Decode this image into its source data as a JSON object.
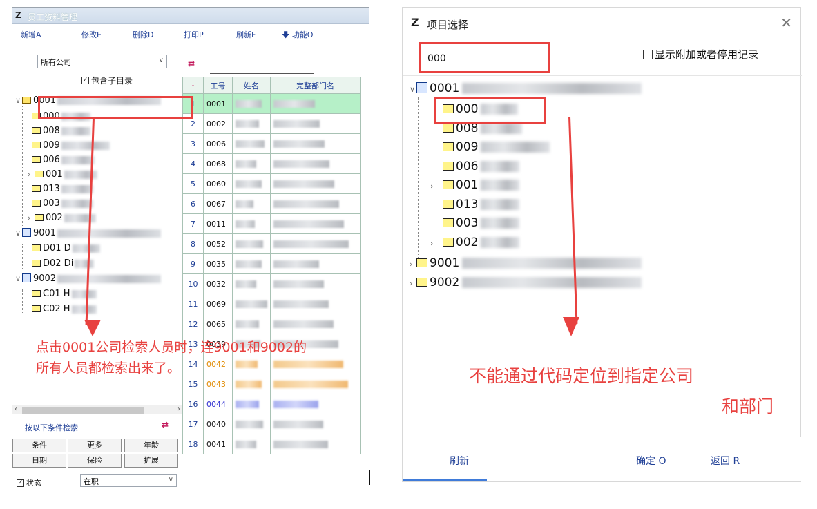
{
  "left": {
    "title": "员工资料管理",
    "toolbar": [
      {
        "label": "新增A"
      },
      {
        "label": "修改E"
      },
      {
        "label": "删除D"
      },
      {
        "label": "打印P"
      },
      {
        "label": "刷新F"
      },
      {
        "label": "功能O"
      }
    ],
    "company_select": "所有公司",
    "include_subdir": "包含子目录",
    "tree": [
      {
        "code": "0001"
      },
      {
        "code": "000"
      },
      {
        "code": "008"
      },
      {
        "code": "009"
      },
      {
        "code": "006"
      },
      {
        "code": "001"
      },
      {
        "code": "013"
      },
      {
        "code": "003"
      },
      {
        "code": "002"
      },
      {
        "code": "9001"
      },
      {
        "code": "D01 D"
      },
      {
        "code": "D02 Di"
      },
      {
        "code": "9002"
      },
      {
        "code": "C01 H"
      },
      {
        "code": "C02 H"
      }
    ],
    "cond_title": "按以下条件检索",
    "cond_buttons": [
      "条件",
      "更多",
      "年龄",
      "日期",
      "保险",
      "扩展"
    ],
    "status_label": "状态",
    "status_value": "在职",
    "grid": {
      "headers": [
        "-",
        "工号",
        "姓名",
        "完整部门名"
      ],
      "rows": [
        {
          "n": "1",
          "code": "0001"
        },
        {
          "n": "2",
          "code": "0002"
        },
        {
          "n": "3",
          "code": "0006"
        },
        {
          "n": "4",
          "code": "0068"
        },
        {
          "n": "5",
          "code": "0060"
        },
        {
          "n": "6",
          "code": "0067"
        },
        {
          "n": "7",
          "code": "0011"
        },
        {
          "n": "8",
          "code": "0052"
        },
        {
          "n": "9",
          "code": "0035"
        },
        {
          "n": "10",
          "code": "0032"
        },
        {
          "n": "11",
          "code": "0069"
        },
        {
          "n": "12",
          "code": "0065"
        },
        {
          "n": "13",
          "code": "0039"
        },
        {
          "n": "14",
          "code": "0042"
        },
        {
          "n": "15",
          "code": "0043"
        },
        {
          "n": "16",
          "code": "0044"
        },
        {
          "n": "17",
          "code": "0040"
        },
        {
          "n": "18",
          "code": "0041"
        }
      ]
    },
    "note_line1": "点击0001公司检索人员时，连9001和9002的",
    "note_line2": "所有人员都检索出来了。"
  },
  "right": {
    "title": "项目选择",
    "search_value": "000",
    "show_extra": "显示附加或者停用记录",
    "tree": [
      {
        "code": "0001"
      },
      {
        "code": "000"
      },
      {
        "code": "008"
      },
      {
        "code": "009"
      },
      {
        "code": "006"
      },
      {
        "code": "001"
      },
      {
        "code": "013"
      },
      {
        "code": "003"
      },
      {
        "code": "002"
      },
      {
        "code": "9001"
      },
      {
        "code": "9002"
      }
    ],
    "note_line1": "不能通过代码定位到指定公司",
    "note_line2": "和部门",
    "footer": {
      "refresh": "刷新",
      "ok": "确定 O",
      "back": "返回 R"
    }
  },
  "colors": {
    "annotation": "#e8413f",
    "link": "#1f3f96",
    "selected_row": "#b6f0c8"
  }
}
